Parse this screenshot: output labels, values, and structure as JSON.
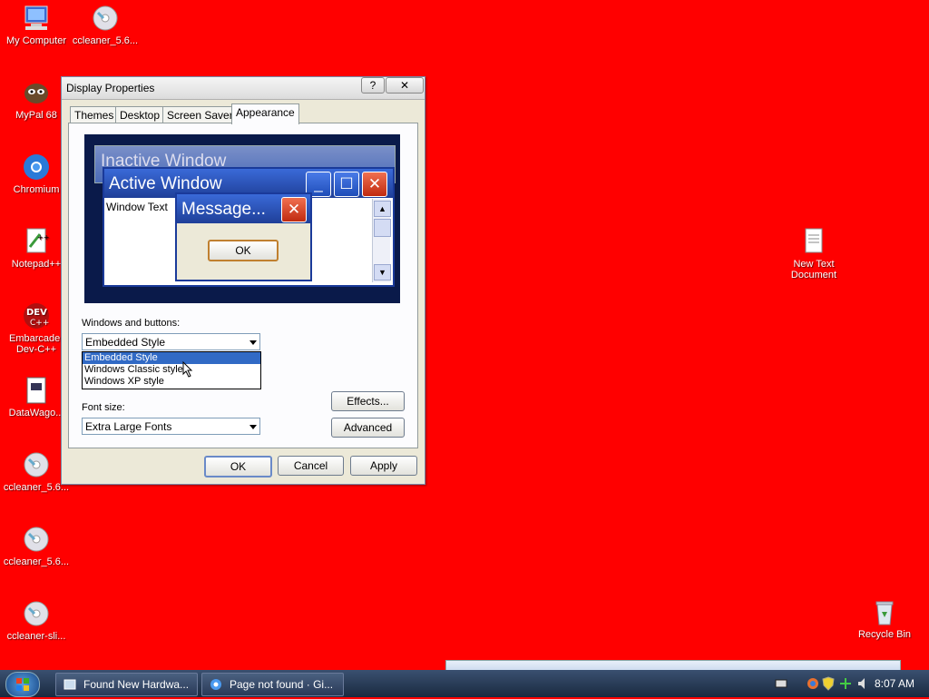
{
  "desktop_icons": [
    {
      "label": "My Computer",
      "icon": "computer-icon"
    },
    {
      "label": "ccleaner_5.6...",
      "icon": "installer-cd-icon"
    },
    {
      "label": "MyPal 68",
      "icon": "mypal-icon"
    },
    {
      "label": "Chromium",
      "icon": "chromium-icon"
    },
    {
      "label": "Notepad++",
      "icon": "notepadpp-icon"
    },
    {
      "label": "Embarcader Dev-C++",
      "icon": "devcpp-icon"
    },
    {
      "label": "DataWago...",
      "icon": "document-icon"
    },
    {
      "label": "ccleaner_5.6...",
      "icon": "installer-cd-icon"
    },
    {
      "label": "ccleaner_5.6...",
      "icon": "installer-cd-icon"
    },
    {
      "label": "ccleaner-sli...",
      "icon": "installer-cd-icon"
    },
    {
      "label": "New Text Document",
      "icon": "text-file-icon"
    },
    {
      "label": "Recycle Bin",
      "icon": "recycle-bin-icon"
    }
  ],
  "dialog": {
    "title": "Display Properties",
    "help_btn": "?",
    "close_btn": "✕",
    "tabs": [
      "Themes",
      "Desktop",
      "Screen Saver",
      "Appearance"
    ],
    "active_tab": "Appearance",
    "preview": {
      "inactive_title": "Inactive Window",
      "active_title": "Active Window",
      "window_text": "Window Text",
      "message_title": "Message...",
      "message_ok": "OK"
    },
    "windows_buttons_label": "Windows and buttons:",
    "windows_buttons_value": "Embedded Style",
    "dropdown_options": [
      "Embedded Style",
      "Windows Classic style",
      "Windows XP style"
    ],
    "dropdown_selected": "Embedded Style",
    "font_size_label": "Font size:",
    "font_size_value": "Extra Large Fonts",
    "effects_btn": "Effects...",
    "advanced_btn": "Advanced",
    "ok_btn": "OK",
    "cancel_btn": "Cancel",
    "apply_btn": "Apply"
  },
  "taskbar": {
    "items": [
      {
        "label": "Found New Hardwa...",
        "icon": "hardware-window-icon"
      },
      {
        "label": "Page not found · Gi...",
        "icon": "chromium-icon"
      }
    ],
    "clock": "8:07 AM",
    "tray_icons": [
      "keyboard-icon",
      "network-icon",
      "security-shield-icon",
      "safely-remove-icon",
      "volume-icon"
    ]
  },
  "colors": {
    "desktop_bg": "#ff0000",
    "selection": "#316ac5"
  }
}
